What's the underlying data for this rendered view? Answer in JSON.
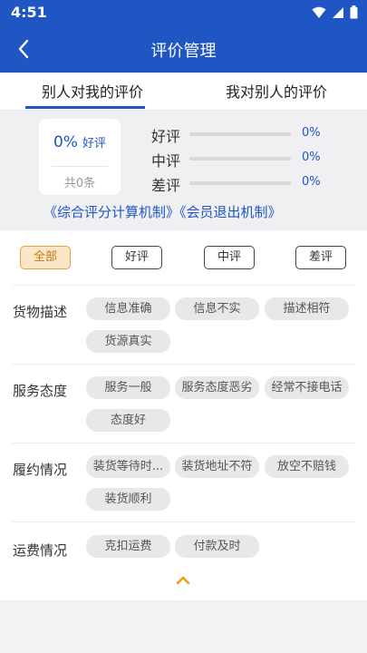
{
  "status_bar": {
    "time": "4:51"
  },
  "nav": {
    "title": "评价管理"
  },
  "tabs": [
    {
      "label": "别人对我的评价",
      "active": true
    },
    {
      "label": "我对别人的评价",
      "active": false
    }
  ],
  "summary": {
    "good_rate_percent": "0%",
    "good_rate_label": "好评",
    "total": "共0条",
    "rates": [
      {
        "label": "好评",
        "percent": "0%",
        "fraction": 0
      },
      {
        "label": "中评",
        "percent": "0%",
        "fraction": 0
      },
      {
        "label": "差评",
        "percent": "0%",
        "fraction": 0
      }
    ],
    "links": [
      "《综合评分计算机制》",
      "《会员退出机制》"
    ]
  },
  "filters": [
    {
      "label": "全部",
      "active": true
    },
    {
      "label": "好评",
      "active": false
    },
    {
      "label": "中评",
      "active": false
    },
    {
      "label": "差评",
      "active": false
    }
  ],
  "categories": [
    {
      "name": "货物描述",
      "tags": [
        "信息准确",
        "信息不实",
        "描述相符",
        "货源真实"
      ]
    },
    {
      "name": "服务态度",
      "tags": [
        "服务一般",
        "服务态度恶劣",
        "经常不接电话",
        "态度好"
      ]
    },
    {
      "name": "履约情况",
      "tags": [
        "装货等待时...",
        "装货地址不符",
        "放空不赔钱",
        "装货顺利"
      ]
    },
    {
      "name": "运费情况",
      "tags": [
        "克扣运费",
        "付款及时"
      ]
    }
  ],
  "colors": {
    "primary": "#1f56c4",
    "accent": "#f39a1e",
    "active_chip_bg": "#fbe6c8"
  },
  "icons": {
    "back": "chevron-left-icon",
    "collapse": "chevron-up-icon"
  }
}
